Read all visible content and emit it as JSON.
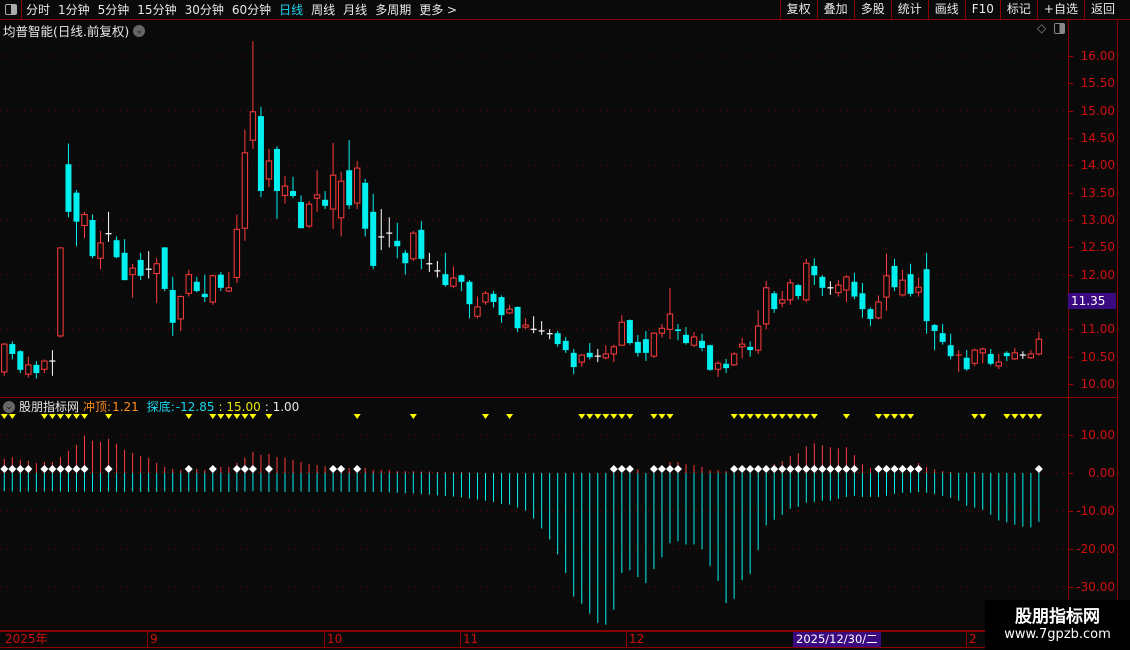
{
  "toolbar": {
    "periods": [
      "分时",
      "1分钟",
      "5分钟",
      "15分钟",
      "30分钟",
      "60分钟",
      "日线",
      "周线",
      "月线",
      "多周期",
      "更多 >"
    ],
    "active_period": "日线",
    "buttons": [
      "复权",
      "叠加",
      "多股",
      "统计",
      "画线",
      "F10",
      "标记",
      "+自选",
      "返回"
    ]
  },
  "title": "均普智能(日线.前复权)",
  "price_axis": {
    "labels": [
      "16.00",
      "15.50",
      "15.00",
      "14.50",
      "14.00",
      "13.50",
      "13.00",
      "12.50",
      "12.00",
      "11.00",
      "10.50",
      "10.00"
    ],
    "last_price": "11.35"
  },
  "indicator": {
    "name": "股朋指标网",
    "top_label": "冲顶:",
    "top_value": "1.21",
    "bottom_label": "探底:",
    "bottom_value": "-12.85",
    "param1": ": 15.00",
    "param2": ": 1.00",
    "axis_labels": [
      "10.00",
      "0.00",
      "-10.00",
      "-20.00",
      "-30.00"
    ]
  },
  "date_axis": {
    "labels": [
      "2025年",
      "9",
      "10",
      "11",
      "12",
      "2"
    ],
    "cursor": "2025/12/30/二"
  },
  "watermark": {
    "name": "股朋指标网",
    "url": "www.7gpzb.com"
  },
  "colors": {
    "up": "#ff3b3b",
    "down": "#00f0f0",
    "doji": "#ffffff",
    "signal": "#ffff00",
    "grid": "#7a0000",
    "axis_text": "#d01010",
    "cursor_bg": "#3a0a80"
  },
  "chart_data": [
    {
      "type": "candlestick",
      "ylim": [
        10.0,
        16.0
      ],
      "grid": true,
      "ohlc": [
        [
          10.22,
          10.75,
          10.15,
          10.73
        ],
        [
          10.73,
          10.78,
          10.45,
          10.55
        ],
        [
          10.6,
          10.62,
          10.2,
          10.26
        ],
        [
          10.18,
          10.5,
          10.12,
          10.35
        ],
        [
          10.35,
          10.42,
          10.1,
          10.2
        ],
        [
          10.27,
          10.45,
          10.2,
          10.42
        ],
        [
          10.42,
          10.62,
          10.15,
          10.42
        ],
        [
          10.88,
          12.5,
          10.85,
          12.49
        ],
        [
          14.02,
          14.4,
          13.05,
          13.15
        ],
        [
          13.5,
          13.55,
          12.52,
          12.97
        ],
        [
          12.9,
          13.15,
          12.67,
          13.1
        ],
        [
          13.0,
          13.1,
          12.3,
          12.34
        ],
        [
          12.3,
          12.8,
          12.1,
          12.58
        ],
        [
          12.75,
          13.15,
          12.6,
          12.75
        ],
        [
          12.63,
          12.7,
          12.3,
          12.32
        ],
        [
          12.4,
          12.65,
          11.9,
          11.9
        ],
        [
          12.0,
          12.2,
          11.58,
          12.12
        ],
        [
          12.27,
          12.4,
          11.9,
          11.98
        ],
        [
          12.1,
          12.43,
          11.93,
          12.1
        ],
        [
          12.02,
          12.3,
          11.48,
          12.2
        ],
        [
          12.5,
          12.5,
          11.7,
          11.74
        ],
        [
          11.72,
          11.96,
          10.88,
          11.12
        ],
        [
          11.19,
          11.62,
          10.97,
          11.6
        ],
        [
          11.66,
          12.09,
          11.6,
          12.0
        ],
        [
          11.87,
          11.96,
          11.68,
          11.7
        ],
        [
          11.65,
          12.0,
          11.5,
          11.59
        ],
        [
          11.5,
          12.0,
          11.45,
          11.98
        ],
        [
          12.0,
          12.05,
          11.7,
          11.76
        ],
        [
          11.7,
          12.05,
          11.68,
          11.76
        ],
        [
          11.95,
          13.1,
          11.85,
          12.83
        ],
        [
          12.85,
          14.65,
          12.62,
          14.23
        ],
        [
          14.46,
          16.27,
          14.3,
          14.98
        ],
        [
          14.9,
          15.07,
          13.42,
          13.53
        ],
        [
          13.75,
          14.3,
          13.6,
          14.08
        ],
        [
          14.3,
          14.35,
          13.02,
          13.53
        ],
        [
          13.45,
          13.8,
          13.3,
          13.62
        ],
        [
          13.53,
          13.79,
          13.4,
          13.44
        ],
        [
          13.33,
          13.45,
          12.85,
          12.85
        ],
        [
          12.89,
          13.35,
          12.85,
          13.29
        ],
        [
          13.4,
          13.91,
          13.15,
          13.46
        ],
        [
          13.37,
          13.53,
          13.2,
          13.26
        ],
        [
          13.2,
          14.41,
          12.84,
          13.82
        ],
        [
          13.04,
          13.88,
          12.7,
          13.71
        ],
        [
          13.91,
          14.46,
          13.2,
          13.27
        ],
        [
          13.31,
          14.08,
          13.2,
          13.95
        ],
        [
          13.68,
          13.75,
          12.7,
          12.84
        ],
        [
          13.15,
          13.48,
          12.1,
          12.16
        ],
        [
          12.69,
          13.2,
          12.45,
          12.69
        ],
        [
          12.76,
          13.05,
          12.5,
          12.76
        ],
        [
          12.62,
          12.95,
          12.3,
          12.52
        ],
        [
          12.4,
          12.45,
          12.0,
          12.21
        ],
        [
          12.29,
          12.8,
          12.25,
          12.76
        ],
        [
          12.82,
          12.98,
          12.1,
          12.29
        ],
        [
          12.2,
          12.4,
          12.05,
          12.2
        ],
        [
          12.07,
          12.25,
          11.95,
          12.07
        ],
        [
          12.01,
          12.4,
          11.78,
          11.81
        ],
        [
          11.79,
          12.15,
          11.75,
          11.94
        ],
        [
          11.99,
          12.0,
          11.7,
          11.87
        ],
        [
          11.87,
          11.9,
          11.2,
          11.46
        ],
        [
          11.24,
          11.6,
          11.2,
          11.41
        ],
        [
          11.5,
          11.7,
          11.45,
          11.66
        ],
        [
          11.65,
          11.7,
          11.4,
          11.5
        ],
        [
          11.59,
          11.62,
          11.12,
          11.26
        ],
        [
          11.3,
          11.45,
          11.28,
          11.37
        ],
        [
          11.41,
          11.42,
          10.95,
          11.02
        ],
        [
          11.04,
          11.2,
          11.0,
          11.08
        ],
        [
          11.0,
          11.24,
          10.93,
          11.0
        ],
        [
          10.97,
          11.15,
          10.9,
          10.97
        ],
        [
          10.92,
          11.0,
          10.82,
          10.92
        ],
        [
          10.93,
          10.97,
          10.68,
          10.73
        ],
        [
          10.79,
          10.86,
          10.57,
          10.62
        ],
        [
          10.57,
          10.64,
          10.18,
          10.31
        ],
        [
          10.4,
          10.55,
          10.32,
          10.53
        ],
        [
          10.57,
          10.75,
          10.45,
          10.49
        ],
        [
          10.51,
          10.64,
          10.4,
          10.51
        ],
        [
          10.48,
          10.71,
          10.45,
          10.55
        ],
        [
          10.55,
          10.72,
          10.4,
          10.68
        ],
        [
          10.71,
          11.26,
          10.7,
          11.13
        ],
        [
          11.17,
          11.18,
          10.72,
          10.75
        ],
        [
          10.77,
          10.9,
          10.5,
          10.57
        ],
        [
          10.82,
          10.97,
          10.42,
          10.57
        ],
        [
          10.51,
          10.95,
          10.48,
          10.93
        ],
        [
          10.93,
          11.1,
          10.85,
          11.02
        ],
        [
          11.0,
          11.76,
          10.82,
          11.28
        ],
        [
          11.0,
          11.1,
          10.8,
          10.97
        ],
        [
          10.9,
          11.04,
          10.72,
          10.75
        ],
        [
          10.71,
          10.95,
          10.68,
          10.86
        ],
        [
          10.79,
          10.92,
          10.6,
          10.66
        ],
        [
          10.71,
          10.72,
          10.24,
          10.26
        ],
        [
          10.27,
          10.42,
          10.13,
          10.38
        ],
        [
          10.37,
          10.46,
          10.2,
          10.29
        ],
        [
          10.35,
          10.58,
          10.33,
          10.55
        ],
        [
          10.68,
          10.84,
          10.47,
          10.73
        ],
        [
          10.68,
          10.78,
          10.5,
          10.62
        ],
        [
          10.62,
          11.35,
          10.55,
          11.06
        ],
        [
          11.1,
          11.88,
          11.0,
          11.76
        ],
        [
          11.66,
          11.7,
          11.3,
          11.37
        ],
        [
          11.48,
          11.7,
          11.4,
          11.54
        ],
        [
          11.54,
          11.92,
          11.45,
          11.85
        ],
        [
          11.81,
          11.83,
          11.55,
          11.61
        ],
        [
          11.54,
          12.29,
          11.5,
          12.21
        ],
        [
          12.16,
          12.3,
          11.81,
          11.99
        ],
        [
          11.96,
          11.99,
          11.61,
          11.76
        ],
        [
          11.76,
          11.88,
          11.63,
          11.76
        ],
        [
          11.67,
          11.9,
          11.6,
          11.81
        ],
        [
          11.72,
          11.99,
          11.5,
          11.96
        ],
        [
          11.87,
          12.03,
          11.55,
          11.6
        ],
        [
          11.66,
          11.85,
          11.21,
          11.37
        ],
        [
          11.37,
          11.4,
          11.06,
          11.19
        ],
        [
          11.21,
          11.62,
          11.18,
          11.5
        ],
        [
          11.59,
          12.39,
          11.34,
          11.98
        ],
        [
          12.16,
          12.29,
          11.7,
          11.77
        ],
        [
          11.63,
          12.09,
          11.6,
          11.9
        ],
        [
          12.01,
          12.2,
          11.6,
          11.65
        ],
        [
          11.68,
          11.95,
          11.6,
          11.77
        ],
        [
          12.1,
          12.4,
          10.92,
          11.15
        ],
        [
          11.08,
          11.1,
          10.62,
          10.97
        ],
        [
          10.93,
          11.1,
          10.72,
          10.77
        ],
        [
          10.71,
          10.92,
          10.45,
          10.51
        ],
        [
          10.51,
          10.62,
          10.22,
          10.53
        ],
        [
          10.48,
          10.62,
          10.24,
          10.27
        ],
        [
          10.38,
          10.65,
          10.33,
          10.62
        ],
        [
          10.57,
          10.67,
          10.38,
          10.64
        ],
        [
          10.55,
          10.64,
          10.34,
          10.37
        ],
        [
          10.33,
          10.55,
          10.27,
          10.4
        ],
        [
          10.57,
          10.6,
          10.42,
          10.51
        ],
        [
          10.46,
          10.66,
          10.44,
          10.57
        ],
        [
          10.53,
          10.6,
          10.46,
          10.53
        ],
        [
          10.48,
          10.62,
          10.46,
          10.55
        ],
        [
          10.55,
          10.95,
          10.52,
          10.82
        ]
      ]
    },
    {
      "type": "bar",
      "ylim": [
        -40,
        13
      ],
      "grid": true,
      "series": [
        {
          "name": "冲顶",
          "values": [
            3.7,
            4.2,
            3.5,
            3.2,
            2.6,
            2.9,
            2.9,
            4.2,
            5.8,
            7.4,
            9.8,
            8.5,
            8.2,
            9.0,
            7.7,
            6.1,
            5.3,
            4.5,
            4.0,
            2.7,
            1.6,
            1.1,
            0.8,
            1.2,
            1.1,
            0.8,
            1.6,
            1.6,
            1.6,
            2.7,
            4.0,
            5.6,
            4.8,
            5.0,
            4.2,
            4.0,
            3.5,
            2.9,
            2.4,
            2.1,
            1.8,
            1.9,
            1.5,
            1.3,
            2.1,
            1.4,
            0.8,
            0.8,
            0.8,
            0.5,
            0.5,
            0.5,
            0.4,
            0.4,
            0.3,
            0.2,
            0.2,
            0.2,
            0.1,
            0.1,
            0,
            0,
            0,
            0,
            0,
            0,
            0,
            0,
            0,
            0,
            0,
            0,
            0,
            0,
            0,
            0,
            0,
            0,
            0,
            1.0,
            0,
            0,
            0,
            2.9,
            2.9,
            2.3,
            2.1,
            1.6,
            0.8,
            0.8,
            0.5,
            0,
            0,
            0,
            0,
            0,
            2.3,
            3.1,
            4.4,
            5.2,
            7.0,
            7.8,
            7.3,
            6.8,
            6.5,
            6.8,
            4.7,
            2.3,
            1.3,
            0,
            0,
            0,
            2.1,
            2.1,
            2.6,
            1.6,
            1.0,
            0.5,
            0.3,
            0,
            0,
            0.3,
            0,
            0,
            0,
            0,
            0,
            0,
            0,
            1.21
          ]
        },
        {
          "name": "探底",
          "values": [
            -4.8,
            -4.9,
            -5.0,
            -4.9,
            -5.0,
            -4.9,
            -4.8,
            -4.9,
            -5.0,
            -5.0,
            -4.9,
            -5.0,
            -5.0,
            -4.9,
            -5.0,
            -5.0,
            -4.9,
            -5.0,
            -5.0,
            -5.0,
            -4.9,
            -5.0,
            -5.0,
            -4.9,
            -5.0,
            -5.0,
            -4.9,
            -5.0,
            -5.0,
            -4.9,
            -4.9,
            -4.8,
            -4.9,
            -5.0,
            -4.9,
            -5.0,
            -5.0,
            -4.9,
            -5.0,
            -5.0,
            -5.0,
            -4.9,
            -4.9,
            -5.0,
            -5.0,
            -5.0,
            -5.0,
            -5.0,
            -5.1,
            -5.2,
            -5.3,
            -5.4,
            -5.5,
            -5.7,
            -5.9,
            -6.0,
            -6.2,
            -6.4,
            -6.7,
            -7.0,
            -7.3,
            -7.6,
            -8.1,
            -8.3,
            -9.1,
            -9.9,
            -12.0,
            -14.6,
            -17.5,
            -21.4,
            -26.3,
            -32.5,
            -34.4,
            -37.0,
            -39.4,
            -39.9,
            -36.0,
            -26.3,
            -25.6,
            -27.4,
            -29.0,
            -25.3,
            -22.2,
            -18.5,
            -18.0,
            -18.8,
            -18.8,
            -20.1,
            -24.5,
            -28.4,
            -34.2,
            -33.1,
            -28.2,
            -26.6,
            -20.3,
            -13.8,
            -12.3,
            -11.0,
            -9.4,
            -8.9,
            -7.8,
            -7.6,
            -7.3,
            -7.3,
            -6.8,
            -6.3,
            -6.0,
            -6.3,
            -6.3,
            -6.3,
            -6.0,
            -5.5,
            -5.2,
            -5.2,
            -5.0,
            -5.2,
            -5.5,
            -6.0,
            -6.5,
            -7.3,
            -8.6,
            -9.1,
            -9.7,
            -11.0,
            -12.5,
            -13.0,
            -13.6,
            -14.1,
            -14.3,
            -12.85
          ]
        }
      ],
      "diamond_signals": [
        0,
        1,
        2,
        3,
        5,
        6,
        7,
        8,
        9,
        10,
        13,
        23,
        26,
        29,
        30,
        31,
        33,
        41,
        42,
        44,
        76,
        77,
        78,
        81,
        82,
        83,
        84,
        91,
        92,
        93,
        94,
        95,
        96,
        97,
        98,
        99,
        100,
        101,
        102,
        103,
        104,
        105,
        106,
        109,
        110,
        111,
        112,
        113,
        114,
        129
      ],
      "triangle_signals": [
        0,
        1,
        5,
        6,
        7,
        8,
        9,
        10,
        13,
        23,
        26,
        27,
        28,
        29,
        30,
        31,
        33,
        44,
        51,
        60,
        63,
        72,
        73,
        74,
        75,
        76,
        77,
        78,
        81,
        82,
        83,
        91,
        92,
        93,
        94,
        95,
        96,
        97,
        98,
        99,
        100,
        101,
        105,
        109,
        110,
        111,
        112,
        113,
        121,
        122,
        125,
        126,
        127,
        128,
        129
      ]
    }
  ]
}
